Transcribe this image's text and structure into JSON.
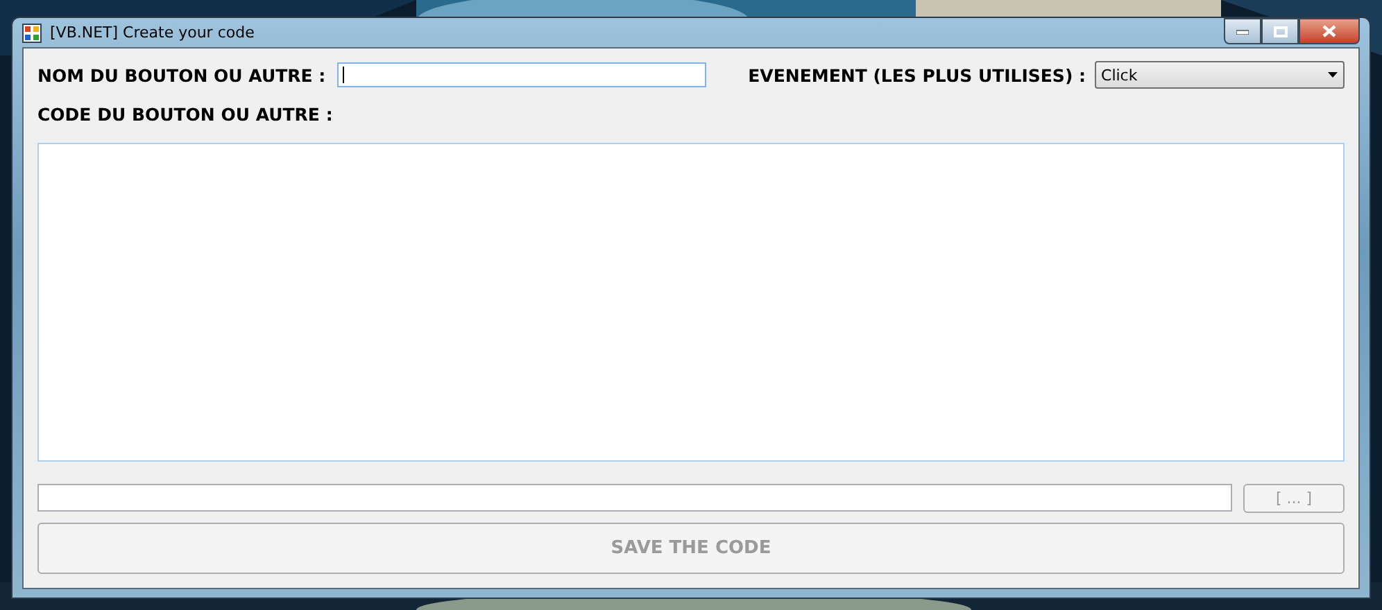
{
  "window": {
    "title": "[VB.NET] Create your code"
  },
  "name_field": {
    "label": "NOM DU BOUTON OU AUTRE :",
    "focused": true
  },
  "event_field": {
    "label": "EVENEMENT (LES PLUS UTILISES) :",
    "value": "Click"
  },
  "code_area": {
    "label": "CODE DU BOUTON OU AUTRE :"
  },
  "browse_button": {
    "label": "[ ... ]",
    "disabled": true
  },
  "save_button": {
    "label": "SAVE THE CODE",
    "disabled": true
  }
}
